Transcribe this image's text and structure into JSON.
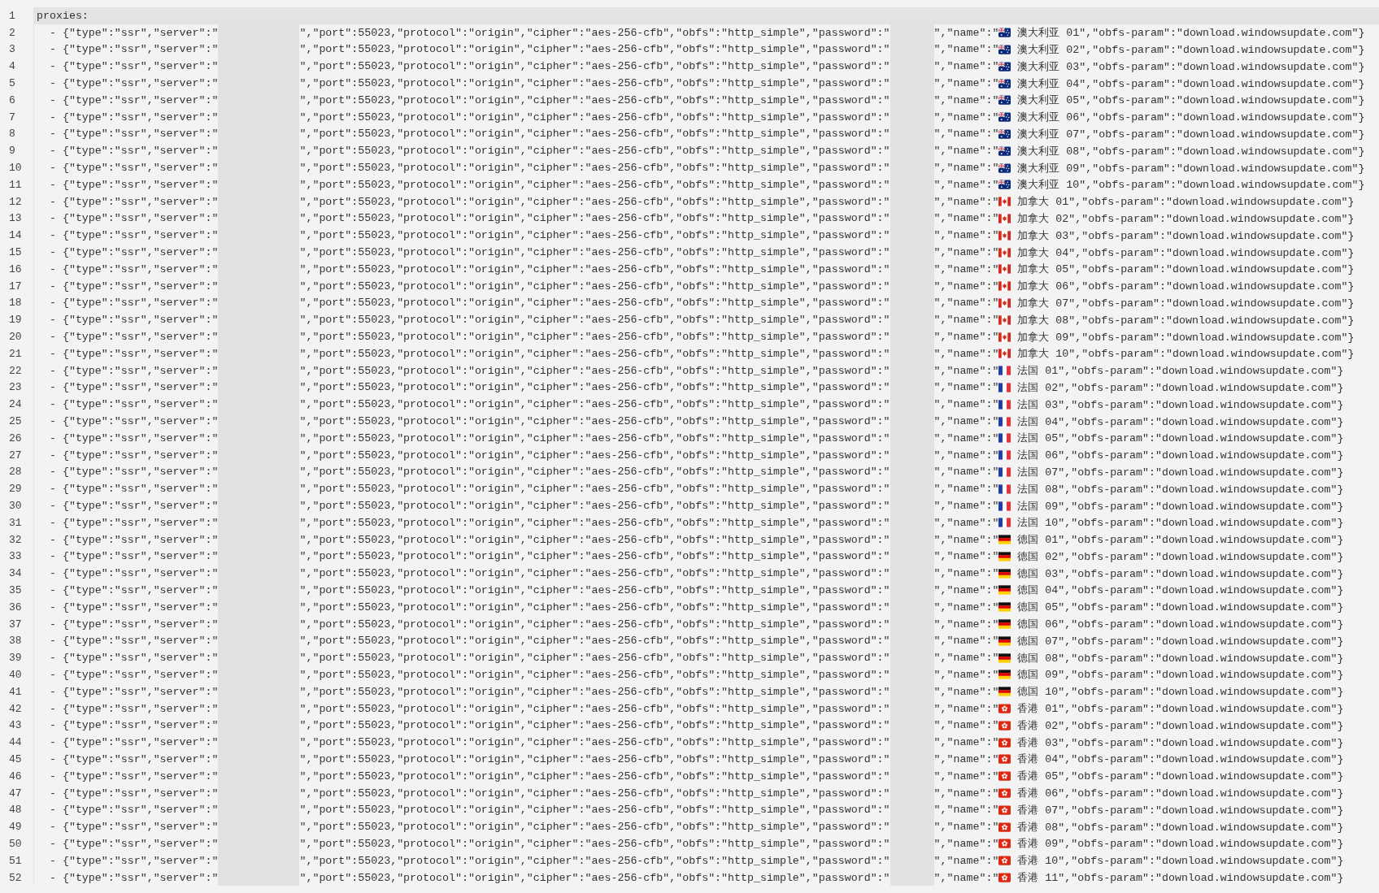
{
  "editor": {
    "lines": [
      {
        "number": "1",
        "current": true,
        "code_1": "proxies:"
      },
      {
        "number": "2",
        "current": false,
        "code_1": "  - {\"type\":\"ssr\",\"server\":\"",
        "code_2": "\",\"port\":55023,\"protocol\":\"origin\",\"cipher\":\"aes-256-cfb\",\"obfs\":\"http_simple\",\"password\":\"",
        "code_3": "\",\"name\":\"",
        "kind": "au",
        "code_4": " 澳大利亚 01\",\"obfs-param\":\"download.windowsupdate.com\"}"
      },
      {
        "number": "3",
        "current": false,
        "code_1": "  - {\"type\":\"ssr\",\"server\":\"",
        "code_2": "\",\"port\":55023,\"protocol\":\"origin\",\"cipher\":\"aes-256-cfb\",\"obfs\":\"http_simple\",\"password\":\"",
        "code_3": "\",\"name\":\"",
        "kind": "au",
        "code_4": " 澳大利亚 02\",\"obfs-param\":\"download.windowsupdate.com\"}"
      },
      {
        "number": "4",
        "current": false,
        "code_1": "  - {\"type\":\"ssr\",\"server\":\"",
        "code_2": "\",\"port\":55023,\"protocol\":\"origin\",\"cipher\":\"aes-256-cfb\",\"obfs\":\"http_simple\",\"password\":\"",
        "code_3": "\",\"name\":\"",
        "kind": "au",
        "code_4": " 澳大利亚 03\",\"obfs-param\":\"download.windowsupdate.com\"}"
      },
      {
        "number": "5",
        "current": false,
        "code_1": "  - {\"type\":\"ssr\",\"server\":\"",
        "code_2": "\",\"port\":55023,\"protocol\":\"origin\",\"cipher\":\"aes-256-cfb\",\"obfs\":\"http_simple\",\"password\":\"",
        "code_3": "\",\"name\":\"",
        "kind": "au",
        "code_4": " 澳大利亚 04\",\"obfs-param\":\"download.windowsupdate.com\"}"
      },
      {
        "number": "6",
        "current": false,
        "code_1": "  - {\"type\":\"ssr\",\"server\":\"",
        "code_2": "\",\"port\":55023,\"protocol\":\"origin\",\"cipher\":\"aes-256-cfb\",\"obfs\":\"http_simple\",\"password\":\"",
        "code_3": "\",\"name\":\"",
        "kind": "au",
        "code_4": " 澳大利亚 05\",\"obfs-param\":\"download.windowsupdate.com\"}"
      },
      {
        "number": "7",
        "current": false,
        "code_1": "  - {\"type\":\"ssr\",\"server\":\"",
        "code_2": "\",\"port\":55023,\"protocol\":\"origin\",\"cipher\":\"aes-256-cfb\",\"obfs\":\"http_simple\",\"password\":\"",
        "code_3": "\",\"name\":\"",
        "kind": "au",
        "code_4": " 澳大利亚 06\",\"obfs-param\":\"download.windowsupdate.com\"}"
      },
      {
        "number": "8",
        "current": false,
        "code_1": "  - {\"type\":\"ssr\",\"server\":\"",
        "code_2": "\",\"port\":55023,\"protocol\":\"origin\",\"cipher\":\"aes-256-cfb\",\"obfs\":\"http_simple\",\"password\":\"",
        "code_3": "\",\"name\":\"",
        "kind": "au",
        "code_4": " 澳大利亚 07\",\"obfs-param\":\"download.windowsupdate.com\"}"
      },
      {
        "number": "9",
        "current": false,
        "code_1": "  - {\"type\":\"ssr\",\"server\":\"",
        "code_2": "\",\"port\":55023,\"protocol\":\"origin\",\"cipher\":\"aes-256-cfb\",\"obfs\":\"http_simple\",\"password\":\"",
        "code_3": "\",\"name\":\"",
        "kind": "au",
        "code_4": " 澳大利亚 08\",\"obfs-param\":\"download.windowsupdate.com\"}"
      },
      {
        "number": "10",
        "current": false,
        "code_1": "  - {\"type\":\"ssr\",\"server\":\"",
        "code_2": "\",\"port\":55023,\"protocol\":\"origin\",\"cipher\":\"aes-256-cfb\",\"obfs\":\"http_simple\",\"password\":\"",
        "code_3": "\",\"name\":\"",
        "kind": "au",
        "code_4": " 澳大利亚 09\",\"obfs-param\":\"download.windowsupdate.com\"}"
      },
      {
        "number": "11",
        "current": false,
        "code_1": "  - {\"type\":\"ssr\",\"server\":\"",
        "code_2": "\",\"port\":55023,\"protocol\":\"origin\",\"cipher\":\"aes-256-cfb\",\"obfs\":\"http_simple\",\"password\":\"",
        "code_3": "\",\"name\":\"",
        "kind": "au",
        "code_4": " 澳大利亚 10\",\"obfs-param\":\"download.windowsupdate.com\"}"
      },
      {
        "number": "12",
        "current": false,
        "code_1": "  - {\"type\":\"ssr\",\"server\":\"",
        "code_2": "\",\"port\":55023,\"protocol\":\"origin\",\"cipher\":\"aes-256-cfb\",\"obfs\":\"http_simple\",\"password\":\"",
        "code_3": "\",\"name\":\"",
        "kind": "ca",
        "code_4": " 加拿大 01\",\"obfs-param\":\"download.windowsupdate.com\"}"
      },
      {
        "number": "13",
        "current": false,
        "code_1": "  - {\"type\":\"ssr\",\"server\":\"",
        "code_2": "\",\"port\":55023,\"protocol\":\"origin\",\"cipher\":\"aes-256-cfb\",\"obfs\":\"http_simple\",\"password\":\"",
        "code_3": "\",\"name\":\"",
        "kind": "ca",
        "code_4": " 加拿大 02\",\"obfs-param\":\"download.windowsupdate.com\"}"
      },
      {
        "number": "14",
        "current": false,
        "code_1": "  - {\"type\":\"ssr\",\"server\":\"",
        "code_2": "\",\"port\":55023,\"protocol\":\"origin\",\"cipher\":\"aes-256-cfb\",\"obfs\":\"http_simple\",\"password\":\"",
        "code_3": "\",\"name\":\"",
        "kind": "ca",
        "code_4": " 加拿大 03\",\"obfs-param\":\"download.windowsupdate.com\"}"
      },
      {
        "number": "15",
        "current": false,
        "code_1": "  - {\"type\":\"ssr\",\"server\":\"",
        "code_2": "\",\"port\":55023,\"protocol\":\"origin\",\"cipher\":\"aes-256-cfb\",\"obfs\":\"http_simple\",\"password\":\"",
        "code_3": "\",\"name\":\"",
        "kind": "ca",
        "code_4": " 加拿大 04\",\"obfs-param\":\"download.windowsupdate.com\"}"
      },
      {
        "number": "16",
        "current": false,
        "code_1": "  - {\"type\":\"ssr\",\"server\":\"",
        "code_2": "\",\"port\":55023,\"protocol\":\"origin\",\"cipher\":\"aes-256-cfb\",\"obfs\":\"http_simple\",\"password\":\"",
        "code_3": "\",\"name\":\"",
        "kind": "ca",
        "code_4": " 加拿大 05\",\"obfs-param\":\"download.windowsupdate.com\"}"
      },
      {
        "number": "17",
        "current": false,
        "code_1": "  - {\"type\":\"ssr\",\"server\":\"",
        "code_2": "\",\"port\":55023,\"protocol\":\"origin\",\"cipher\":\"aes-256-cfb\",\"obfs\":\"http_simple\",\"password\":\"",
        "code_3": "\",\"name\":\"",
        "kind": "ca",
        "code_4": " 加拿大 06\",\"obfs-param\":\"download.windowsupdate.com\"}"
      },
      {
        "number": "18",
        "current": false,
        "code_1": "  - {\"type\":\"ssr\",\"server\":\"",
        "code_2": "\",\"port\":55023,\"protocol\":\"origin\",\"cipher\":\"aes-256-cfb\",\"obfs\":\"http_simple\",\"password\":\"",
        "code_3": "\",\"name\":\"",
        "kind": "ca",
        "code_4": " 加拿大 07\",\"obfs-param\":\"download.windowsupdate.com\"}"
      },
      {
        "number": "19",
        "current": false,
        "code_1": "  - {\"type\":\"ssr\",\"server\":\"",
        "code_2": "\",\"port\":55023,\"protocol\":\"origin\",\"cipher\":\"aes-256-cfb\",\"obfs\":\"http_simple\",\"password\":\"",
        "code_3": "\",\"name\":\"",
        "kind": "ca",
        "code_4": " 加拿大 08\",\"obfs-param\":\"download.windowsupdate.com\"}"
      },
      {
        "number": "20",
        "current": false,
        "code_1": "  - {\"type\":\"ssr\",\"server\":\"",
        "code_2": "\",\"port\":55023,\"protocol\":\"origin\",\"cipher\":\"aes-256-cfb\",\"obfs\":\"http_simple\",\"password\":\"",
        "code_3": "\",\"name\":\"",
        "kind": "ca",
        "code_4": " 加拿大 09\",\"obfs-param\":\"download.windowsupdate.com\"}"
      },
      {
        "number": "21",
        "current": false,
        "code_1": "  - {\"type\":\"ssr\",\"server\":\"",
        "code_2": "\",\"port\":55023,\"protocol\":\"origin\",\"cipher\":\"aes-256-cfb\",\"obfs\":\"http_simple\",\"password\":\"",
        "code_3": "\",\"name\":\"",
        "kind": "ca",
        "code_4": " 加拿大 10\",\"obfs-param\":\"download.windowsupdate.com\"}"
      },
      {
        "number": "22",
        "current": false,
        "code_1": "  - {\"type\":\"ssr\",\"server\":\"",
        "code_2": "\",\"port\":55023,\"protocol\":\"origin\",\"cipher\":\"aes-256-cfb\",\"obfs\":\"http_simple\",\"password\":\"",
        "code_3": "\",\"name\":\"",
        "kind": "fr",
        "code_4": " 法国 01\",\"obfs-param\":\"download.windowsupdate.com\"}"
      },
      {
        "number": "23",
        "current": false,
        "code_1": "  - {\"type\":\"ssr\",\"server\":\"",
        "code_2": "\",\"port\":55023,\"protocol\":\"origin\",\"cipher\":\"aes-256-cfb\",\"obfs\":\"http_simple\",\"password\":\"",
        "code_3": "\",\"name\":\"",
        "kind": "fr",
        "code_4": " 法国 02\",\"obfs-param\":\"download.windowsupdate.com\"}"
      },
      {
        "number": "24",
        "current": false,
        "code_1": "  - {\"type\":\"ssr\",\"server\":\"",
        "code_2": "\",\"port\":55023,\"protocol\":\"origin\",\"cipher\":\"aes-256-cfb\",\"obfs\":\"http_simple\",\"password\":\"",
        "code_3": "\",\"name\":\"",
        "kind": "fr",
        "code_4": " 法国 03\",\"obfs-param\":\"download.windowsupdate.com\"}"
      },
      {
        "number": "25",
        "current": false,
        "code_1": "  - {\"type\":\"ssr\",\"server\":\"",
        "code_2": "\",\"port\":55023,\"protocol\":\"origin\",\"cipher\":\"aes-256-cfb\",\"obfs\":\"http_simple\",\"password\":\"",
        "code_3": "\",\"name\":\"",
        "kind": "fr",
        "code_4": " 法国 04\",\"obfs-param\":\"download.windowsupdate.com\"}"
      },
      {
        "number": "26",
        "current": false,
        "code_1": "  - {\"type\":\"ssr\",\"server\":\"",
        "code_2": "\",\"port\":55023,\"protocol\":\"origin\",\"cipher\":\"aes-256-cfb\",\"obfs\":\"http_simple\",\"password\":\"",
        "code_3": "\",\"name\":\"",
        "kind": "fr",
        "code_4": " 法国 05\",\"obfs-param\":\"download.windowsupdate.com\"}"
      },
      {
        "number": "27",
        "current": false,
        "code_1": "  - {\"type\":\"ssr\",\"server\":\"",
        "code_2": "\",\"port\":55023,\"protocol\":\"origin\",\"cipher\":\"aes-256-cfb\",\"obfs\":\"http_simple\",\"password\":\"",
        "code_3": "\",\"name\":\"",
        "kind": "fr",
        "code_4": " 法国 06\",\"obfs-param\":\"download.windowsupdate.com\"}"
      },
      {
        "number": "28",
        "current": false,
        "code_1": "  - {\"type\":\"ssr\",\"server\":\"",
        "code_2": "\",\"port\":55023,\"protocol\":\"origin\",\"cipher\":\"aes-256-cfb\",\"obfs\":\"http_simple\",\"password\":\"",
        "code_3": "\",\"name\":\"",
        "kind": "fr",
        "code_4": " 法国 07\",\"obfs-param\":\"download.windowsupdate.com\"}"
      },
      {
        "number": "29",
        "current": false,
        "code_1": "  - {\"type\":\"ssr\",\"server\":\"",
        "code_2": "\",\"port\":55023,\"protocol\":\"origin\",\"cipher\":\"aes-256-cfb\",\"obfs\":\"http_simple\",\"password\":\"",
        "code_3": "\",\"name\":\"",
        "kind": "fr",
        "code_4": " 法国 08\",\"obfs-param\":\"download.windowsupdate.com\"}"
      },
      {
        "number": "30",
        "current": false,
        "code_1": "  - {\"type\":\"ssr\",\"server\":\"",
        "code_2": "\",\"port\":55023,\"protocol\":\"origin\",\"cipher\":\"aes-256-cfb\",\"obfs\":\"http_simple\",\"password\":\"",
        "code_3": "\",\"name\":\"",
        "kind": "fr",
        "code_4": " 法国 09\",\"obfs-param\":\"download.windowsupdate.com\"}"
      },
      {
        "number": "31",
        "current": false,
        "code_1": "  - {\"type\":\"ssr\",\"server\":\"",
        "code_2": "\",\"port\":55023,\"protocol\":\"origin\",\"cipher\":\"aes-256-cfb\",\"obfs\":\"http_simple\",\"password\":\"",
        "code_3": "\",\"name\":\"",
        "kind": "fr",
        "code_4": " 法国 10\",\"obfs-param\":\"download.windowsupdate.com\"}"
      },
      {
        "number": "32",
        "current": false,
        "code_1": "  - {\"type\":\"ssr\",\"server\":\"",
        "code_2": "\",\"port\":55023,\"protocol\":\"origin\",\"cipher\":\"aes-256-cfb\",\"obfs\":\"http_simple\",\"password\":\"",
        "code_3": "\",\"name\":\"",
        "kind": "de",
        "code_4": " 德国 01\",\"obfs-param\":\"download.windowsupdate.com\"}"
      },
      {
        "number": "33",
        "current": false,
        "code_1": "  - {\"type\":\"ssr\",\"server\":\"",
        "code_2": "\",\"port\":55023,\"protocol\":\"origin\",\"cipher\":\"aes-256-cfb\",\"obfs\":\"http_simple\",\"password\":\"",
        "code_3": "\",\"name\":\"",
        "kind": "de",
        "code_4": " 德国 02\",\"obfs-param\":\"download.windowsupdate.com\"}"
      },
      {
        "number": "34",
        "current": false,
        "code_1": "  - {\"type\":\"ssr\",\"server\":\"",
        "code_2": "\",\"port\":55023,\"protocol\":\"origin\",\"cipher\":\"aes-256-cfb\",\"obfs\":\"http_simple\",\"password\":\"",
        "code_3": "\",\"name\":\"",
        "kind": "de",
        "code_4": " 德国 03\",\"obfs-param\":\"download.windowsupdate.com\"}"
      },
      {
        "number": "35",
        "current": false,
        "code_1": "  - {\"type\":\"ssr\",\"server\":\"",
        "code_2": "\",\"port\":55023,\"protocol\":\"origin\",\"cipher\":\"aes-256-cfb\",\"obfs\":\"http_simple\",\"password\":\"",
        "code_3": "\",\"name\":\"",
        "kind": "de",
        "code_4": " 德国 04\",\"obfs-param\":\"download.windowsupdate.com\"}"
      },
      {
        "number": "36",
        "current": false,
        "code_1": "  - {\"type\":\"ssr\",\"server\":\"",
        "code_2": "\",\"port\":55023,\"protocol\":\"origin\",\"cipher\":\"aes-256-cfb\",\"obfs\":\"http_simple\",\"password\":\"",
        "code_3": "\",\"name\":\"",
        "kind": "de",
        "code_4": " 德国 05\",\"obfs-param\":\"download.windowsupdate.com\"}"
      },
      {
        "number": "37",
        "current": false,
        "code_1": "  - {\"type\":\"ssr\",\"server\":\"",
        "code_2": "\",\"port\":55023,\"protocol\":\"origin\",\"cipher\":\"aes-256-cfb\",\"obfs\":\"http_simple\",\"password\":\"",
        "code_3": "\",\"name\":\"",
        "kind": "de",
        "code_4": " 德国 06\",\"obfs-param\":\"download.windowsupdate.com\"}"
      },
      {
        "number": "38",
        "current": false,
        "code_1": "  - {\"type\":\"ssr\",\"server\":\"",
        "code_2": "\",\"port\":55023,\"protocol\":\"origin\",\"cipher\":\"aes-256-cfb\",\"obfs\":\"http_simple\",\"password\":\"",
        "code_3": "\",\"name\":\"",
        "kind": "de",
        "code_4": " 德国 07\",\"obfs-param\":\"download.windowsupdate.com\"}"
      },
      {
        "number": "39",
        "current": false,
        "code_1": "  - {\"type\":\"ssr\",\"server\":\"",
        "code_2": "\",\"port\":55023,\"protocol\":\"origin\",\"cipher\":\"aes-256-cfb\",\"obfs\":\"http_simple\",\"password\":\"",
        "code_3": "\",\"name\":\"",
        "kind": "de",
        "code_4": " 德国 08\",\"obfs-param\":\"download.windowsupdate.com\"}"
      },
      {
        "number": "40",
        "current": false,
        "code_1": "  - {\"type\":\"ssr\",\"server\":\"",
        "code_2": "\",\"port\":55023,\"protocol\":\"origin\",\"cipher\":\"aes-256-cfb\",\"obfs\":\"http_simple\",\"password\":\"",
        "code_3": "\",\"name\":\"",
        "kind": "de",
        "code_4": " 德国 09\",\"obfs-param\":\"download.windowsupdate.com\"}"
      },
      {
        "number": "41",
        "current": false,
        "code_1": "  - {\"type\":\"ssr\",\"server\":\"",
        "code_2": "\",\"port\":55023,\"protocol\":\"origin\",\"cipher\":\"aes-256-cfb\",\"obfs\":\"http_simple\",\"password\":\"",
        "code_3": "\",\"name\":\"",
        "kind": "de",
        "code_4": " 德国 10\",\"obfs-param\":\"download.windowsupdate.com\"}"
      },
      {
        "number": "42",
        "current": false,
        "code_1": "  - {\"type\":\"ssr\",\"server\":\"",
        "code_2": "\",\"port\":55023,\"protocol\":\"origin\",\"cipher\":\"aes-256-cfb\",\"obfs\":\"http_simple\",\"password\":\"",
        "code_3": "\",\"name\":\"",
        "kind": "hk",
        "code_4": " 香港 01\",\"obfs-param\":\"download.windowsupdate.com\"}"
      },
      {
        "number": "43",
        "current": false,
        "code_1": "  - {\"type\":\"ssr\",\"server\":\"",
        "code_2": "\",\"port\":55023,\"protocol\":\"origin\",\"cipher\":\"aes-256-cfb\",\"obfs\":\"http_simple\",\"password\":\"",
        "code_3": "\",\"name\":\"",
        "kind": "hk",
        "code_4": " 香港 02\",\"obfs-param\":\"download.windowsupdate.com\"}"
      },
      {
        "number": "44",
        "current": false,
        "code_1": "  - {\"type\":\"ssr\",\"server\":\"",
        "code_2": "\",\"port\":55023,\"protocol\":\"origin\",\"cipher\":\"aes-256-cfb\",\"obfs\":\"http_simple\",\"password\":\"",
        "code_3": "\",\"name\":\"",
        "kind": "hk",
        "code_4": " 香港 03\",\"obfs-param\":\"download.windowsupdate.com\"}"
      },
      {
        "number": "45",
        "current": false,
        "code_1": "  - {\"type\":\"ssr\",\"server\":\"",
        "code_2": "\",\"port\":55023,\"protocol\":\"origin\",\"cipher\":\"aes-256-cfb\",\"obfs\":\"http_simple\",\"password\":\"",
        "code_3": "\",\"name\":\"",
        "kind": "hk",
        "code_4": " 香港 04\",\"obfs-param\":\"download.windowsupdate.com\"}"
      },
      {
        "number": "46",
        "current": false,
        "code_1": "  - {\"type\":\"ssr\",\"server\":\"",
        "code_2": "\",\"port\":55023,\"protocol\":\"origin\",\"cipher\":\"aes-256-cfb\",\"obfs\":\"http_simple\",\"password\":\"",
        "code_3": "\",\"name\":\"",
        "kind": "hk",
        "code_4": " 香港 05\",\"obfs-param\":\"download.windowsupdate.com\"}"
      },
      {
        "number": "47",
        "current": false,
        "code_1": "  - {\"type\":\"ssr\",\"server\":\"",
        "code_2": "\",\"port\":55023,\"protocol\":\"origin\",\"cipher\":\"aes-256-cfb\",\"obfs\":\"http_simple\",\"password\":\"",
        "code_3": "\",\"name\":\"",
        "kind": "hk",
        "code_4": " 香港 06\",\"obfs-param\":\"download.windowsupdate.com\"}"
      },
      {
        "number": "48",
        "current": false,
        "code_1": "  - {\"type\":\"ssr\",\"server\":\"",
        "code_2": "\",\"port\":55023,\"protocol\":\"origin\",\"cipher\":\"aes-256-cfb\",\"obfs\":\"http_simple\",\"password\":\"",
        "code_3": "\",\"name\":\"",
        "kind": "hk",
        "code_4": " 香港 07\",\"obfs-param\":\"download.windowsupdate.com\"}"
      },
      {
        "number": "49",
        "current": false,
        "code_1": "  - {\"type\":\"ssr\",\"server\":\"",
        "code_2": "\",\"port\":55023,\"protocol\":\"origin\",\"cipher\":\"aes-256-cfb\",\"obfs\":\"http_simple\",\"password\":\"",
        "code_3": "\",\"name\":\"",
        "kind": "hk",
        "code_4": " 香港 08\",\"obfs-param\":\"download.windowsupdate.com\"}"
      },
      {
        "number": "50",
        "current": false,
        "code_1": "  - {\"type\":\"ssr\",\"server\":\"",
        "code_2": "\",\"port\":55023,\"protocol\":\"origin\",\"cipher\":\"aes-256-cfb\",\"obfs\":\"http_simple\",\"password\":\"",
        "code_3": "\",\"name\":\"",
        "kind": "hk",
        "code_4": " 香港 09\",\"obfs-param\":\"download.windowsupdate.com\"}"
      },
      {
        "number": "51",
        "current": false,
        "code_1": "  - {\"type\":\"ssr\",\"server\":\"",
        "code_2": "\",\"port\":55023,\"protocol\":\"origin\",\"cipher\":\"aes-256-cfb\",\"obfs\":\"http_simple\",\"password\":\"",
        "code_3": "\",\"name\":\"",
        "kind": "hk",
        "code_4": " 香港 10\",\"obfs-param\":\"download.windowsupdate.com\"}"
      },
      {
        "number": "52",
        "current": false,
        "code_1": "  - {\"type\":\"ssr\",\"server\":\"",
        "code_2": "\",\"port\":55023,\"protocol\":\"origin\",\"cipher\":\"aes-256-cfb\",\"obfs\":\"http_simple\",\"password\":\"",
        "code_3": "\",\"name\":\"",
        "kind": "hk",
        "code_4": " 香港 11\",\"obfs-param\":\"download.windowsupdate.com\"}"
      }
    ]
  }
}
